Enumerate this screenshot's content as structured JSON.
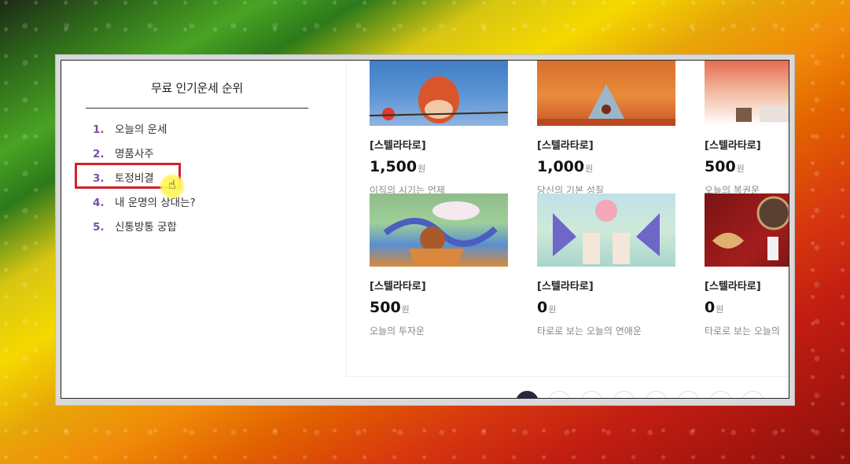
{
  "ranking": {
    "title": "무료 인기운세 순위",
    "items": [
      {
        "num": "1.",
        "label": "오늘의 운세"
      },
      {
        "num": "2.",
        "label": "명품사주"
      },
      {
        "num": "3.",
        "label": "토정비결"
      },
      {
        "num": "4.",
        "label": "내 운명의 상대는?"
      },
      {
        "num": "5.",
        "label": "신통방통 궁합"
      }
    ]
  },
  "products": [
    {
      "tag": "[스텔라타로]",
      "price": "1,500",
      "unit": "원",
      "desc": "이직의 시기는 언제"
    },
    {
      "tag": "[스텔라타로]",
      "price": "1,000",
      "unit": "원",
      "desc": "당신의 기본 성질"
    },
    {
      "tag": "[스텔라타로]",
      "price": "500",
      "unit": "원",
      "desc": "오늘의 복권운"
    },
    {
      "tag": "[스텔라타로]",
      "price": "500",
      "unit": "원",
      "desc": "오늘의 투자운"
    },
    {
      "tag": "[스텔라타로]",
      "price": "0",
      "unit": "원",
      "desc": "타로로 보는 오늘의 연애운"
    },
    {
      "tag": "[스텔라타로]",
      "price": "0",
      "unit": "원",
      "desc": "타로로 보는 오늘의"
    }
  ],
  "pagination": {
    "active_index": 0,
    "count": 8
  },
  "colors": {
    "rank_number": "#7a4fa8",
    "highlight": "#d4202c",
    "active_page": "#2b2740"
  }
}
